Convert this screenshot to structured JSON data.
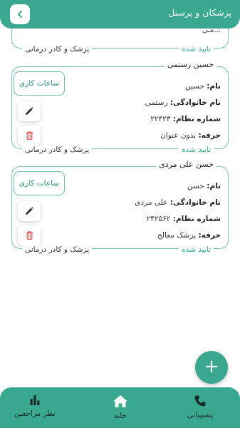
{
  "header": {
    "title": "پزشکان و پرسنل",
    "back_icon": "chevron-left-icon"
  },
  "partial_card": {
    "name_fragment": "...مـی",
    "role": "پزشک و کادر درمانی",
    "status": "تایید شده"
  },
  "cards": [
    {
      "name": "حسین رستمی",
      "hours_label": "ساعات کاری",
      "rows": [
        {
          "label": "نام:",
          "value": "حسین"
        },
        {
          "label": "نام خانوادگی:",
          "value": "رستمی"
        },
        {
          "label": "شماره نظام:",
          "value": "۲۲۴۲۳"
        },
        {
          "label": "حرفه:",
          "value": "بدون عنوان"
        }
      ],
      "role": "پزشک و کادر درمانی",
      "status": "تایید شده"
    },
    {
      "name": "حسن علی مردی",
      "hours_label": "ساعات کاری",
      "rows": [
        {
          "label": "نام:",
          "value": "حسن"
        },
        {
          "label": "نام خانوادگی:",
          "value": "علی مردی"
        },
        {
          "label": "شماره نظام:",
          "value": "۲۴۲۵۶۲"
        },
        {
          "label": "حرفه:",
          "value": "پزشک معالج"
        }
      ],
      "role": "پزشک و کادر درمانی",
      "status": "تایید شده"
    }
  ],
  "fab": {
    "label": "+"
  },
  "bottom_nav": {
    "items": [
      {
        "label": "پشتیبانی",
        "icon": "phone-icon"
      },
      {
        "label": "خانه",
        "icon": "home-icon"
      },
      {
        "label": "نظر مراجعین",
        "icon": "bar-chart-icon"
      }
    ]
  },
  "colors": {
    "primary": "#3aa890",
    "delete": "#e05a5a",
    "border": "#7cc3b1"
  }
}
